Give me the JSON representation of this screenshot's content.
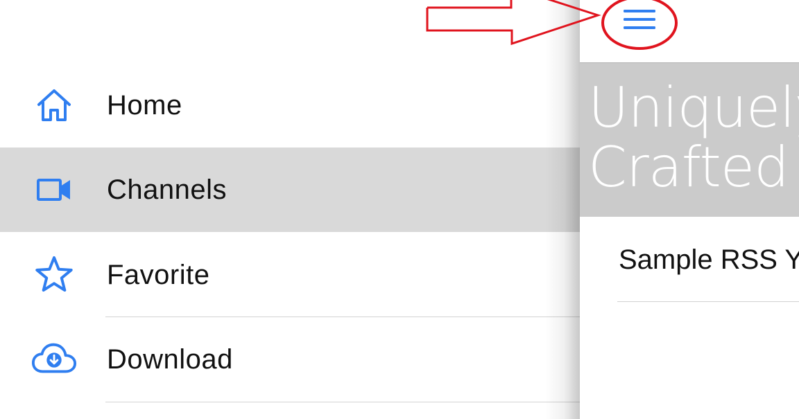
{
  "side_menu": {
    "items": [
      {
        "label": "Home",
        "icon": "home-icon",
        "active": false
      },
      {
        "label": "Channels",
        "icon": "video-camera-icon",
        "active": true
      },
      {
        "label": "Favorite",
        "icon": "star-icon",
        "active": false
      },
      {
        "label": "Download",
        "icon": "cloud-download-icon",
        "active": false
      }
    ]
  },
  "main": {
    "menu_button_icon": "hamburger-menu-icon",
    "hero_title": "Uniquely\nCrafted",
    "feed_items": [
      {
        "title": "Sample RSS Y"
      }
    ]
  },
  "annotation": {
    "shape": "arrow-and-circle",
    "color": "#e0141e"
  },
  "colors": {
    "accent": "#2f7ef0",
    "active_row": "#d9d9d9",
    "hero_background": "#cbcbcb",
    "annotation": "#e0141e"
  }
}
